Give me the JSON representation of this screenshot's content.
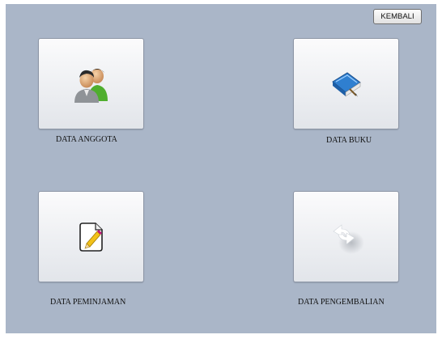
{
  "toolbar": {
    "back_label": "KEMBALI"
  },
  "menu": {
    "items": [
      {
        "id": "anggota",
        "label": "DATA ANGGOTA",
        "icon": "users-icon"
      },
      {
        "id": "buku",
        "label": "DATA BUKU",
        "icon": "book-icon"
      },
      {
        "id": "peminjaman",
        "label": "DATA PEMINJAMAN",
        "icon": "edit-document-icon"
      },
      {
        "id": "pengembalian",
        "label": "DATA PENGEMBALIAN",
        "icon": "refresh-arrows-icon"
      }
    ]
  },
  "colors": {
    "panel_background": "#aab6c8",
    "tile_background": "#f3f4f6"
  }
}
